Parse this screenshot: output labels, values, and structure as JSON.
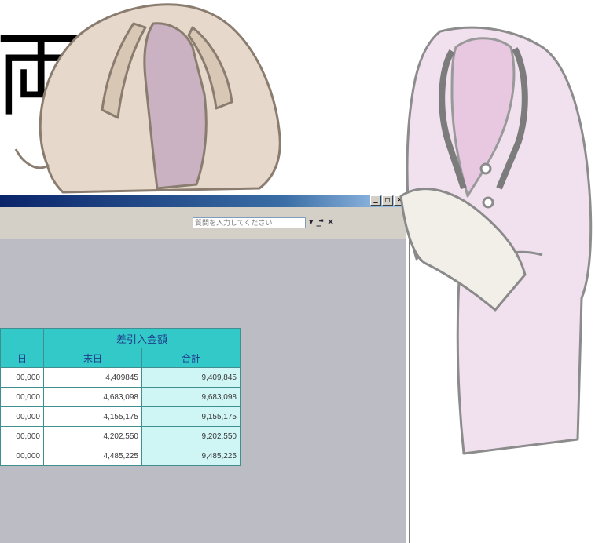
{
  "slide": {
    "heading_glyph": "両"
  },
  "excel_window": {
    "title": "",
    "controls": {
      "minimize": "_",
      "restore": "□",
      "close": "×"
    },
    "menubar": {
      "help_placeholder": "質問を入力してください",
      "mdi_dropdown": "▾",
      "mdi_minimize": "_",
      "mdi_restore": "ื",
      "mdi_close": "×"
    }
  },
  "table": {
    "group_header": "差引入金額",
    "column_headers": [
      "日",
      "末日",
      "合計"
    ],
    "rows": [
      [
        "00,000",
        "4,409845",
        "9,409,845"
      ],
      [
        "00,000",
        "4,683,098",
        "9,683,098"
      ],
      [
        "00,000",
        "4,155,175",
        "9,155,175"
      ],
      [
        "00,000",
        "4,202,550",
        "9,202,550"
      ],
      [
        "00,000",
        "4,485,225",
        "9,485,225"
      ]
    ]
  },
  "colors": {
    "header_fill": "#33c9c9",
    "header_text": "#1d3c8a",
    "sum_fill": "#cff5f5",
    "window_body": "#bcbcc4",
    "jacket_beige": "#e6d9cb",
    "jacket_pink": "#f1e1ee"
  }
}
